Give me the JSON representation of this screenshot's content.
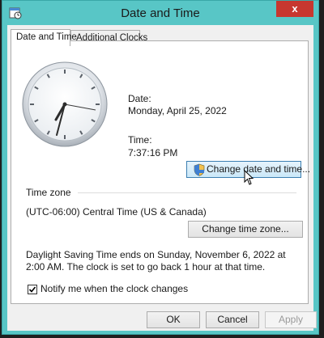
{
  "window": {
    "title": "Date and Time",
    "close_symbol": "x"
  },
  "tabs": [
    {
      "label": "Date and Time",
      "active": true
    },
    {
      "label": "Additional Clocks",
      "active": false
    }
  ],
  "datetime": {
    "date_label": "Date:",
    "date_value": "Monday, April 25, 2022",
    "time_label": "Time:",
    "time_value": "7:37:16 PM",
    "change_button": "Change date and time..."
  },
  "timezone": {
    "group_label": "Time zone",
    "value": "(UTC-06:00) Central Time (US & Canada)",
    "change_button": "Change time zone..."
  },
  "dst": {
    "message": "Daylight Saving Time ends on Sunday, November 6, 2022 at 2:00 AM. The clock is set to go back 1 hour at that time."
  },
  "notify": {
    "label": "Notify me when the clock changes",
    "checked": true
  },
  "footer": {
    "ok": "OK",
    "cancel": "Cancel",
    "apply": "Apply"
  },
  "icons": {
    "app": "date-time-icon",
    "shield": "uac-shield-icon",
    "cursor": "mouse-pointer-icon"
  },
  "colors": {
    "title_bar": "#58c6c6",
    "close_button": "#c7372f",
    "focus_border": "#3c7fb1"
  }
}
